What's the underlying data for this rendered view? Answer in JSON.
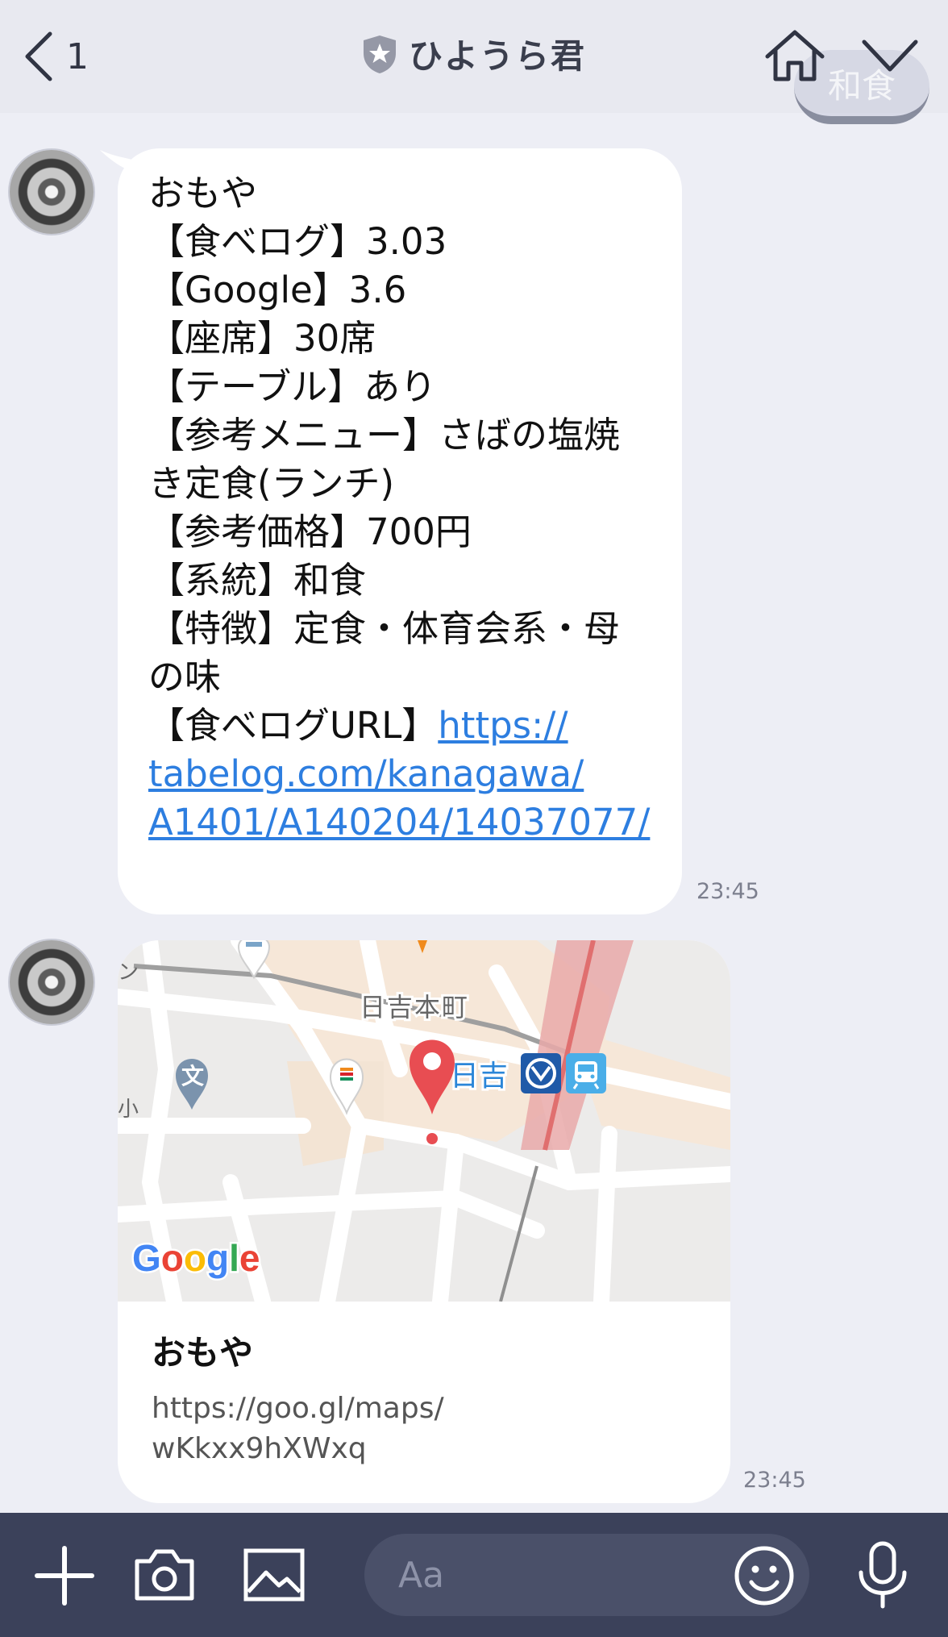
{
  "header": {
    "back_count": "1",
    "title": "ひようら君",
    "ghost_label": "和食"
  },
  "messages": [
    {
      "lines": [
        "おもや",
        "【食べログ】3.03",
        "【Google】3.6",
        "【座席】30席",
        "【テーブル】あり",
        "【参考メニュー】さばの塩焼",
        "き定食(ランチ)",
        "【参考価格】700円",
        "【系統】和食",
        "【特徴】定食・体育会系・母",
        "の味"
      ],
      "url_label": "【食べログURL】",
      "url_lines": [
        "https://",
        "tabelog.com/kanagawa/",
        "A1401/A140204/14037077/"
      ],
      "time": "23:45"
    },
    {
      "map": {
        "district": "日吉本町",
        "station": "日吉",
        "school_icon": "文",
        "edge_text_left": "小",
        "edge_text_top": "ン",
        "google_logo": "Google"
      },
      "title": "おもや",
      "url": "https://goo.gl/maps/wKkxx9hXWxq",
      "url_lines": [
        "https://goo.gl/maps/",
        "wKkxx9hXWxq"
      ],
      "time": "23:45"
    }
  ],
  "input": {
    "placeholder": "Aa"
  },
  "icons": [
    "back-chevron-icon",
    "shield-icon",
    "home-icon",
    "chevron-down-icon",
    "plus-icon",
    "camera-icon",
    "image-icon",
    "emoji-icon",
    "microphone-icon",
    "map-pin-icon",
    "school-icon",
    "seven-eleven-icon",
    "subway-icon",
    "train-icon"
  ],
  "colors": {
    "background": "#edeef5",
    "link": "#2d7ee0",
    "input_bar": "#3b415a",
    "map_pin": "#e84d52"
  }
}
